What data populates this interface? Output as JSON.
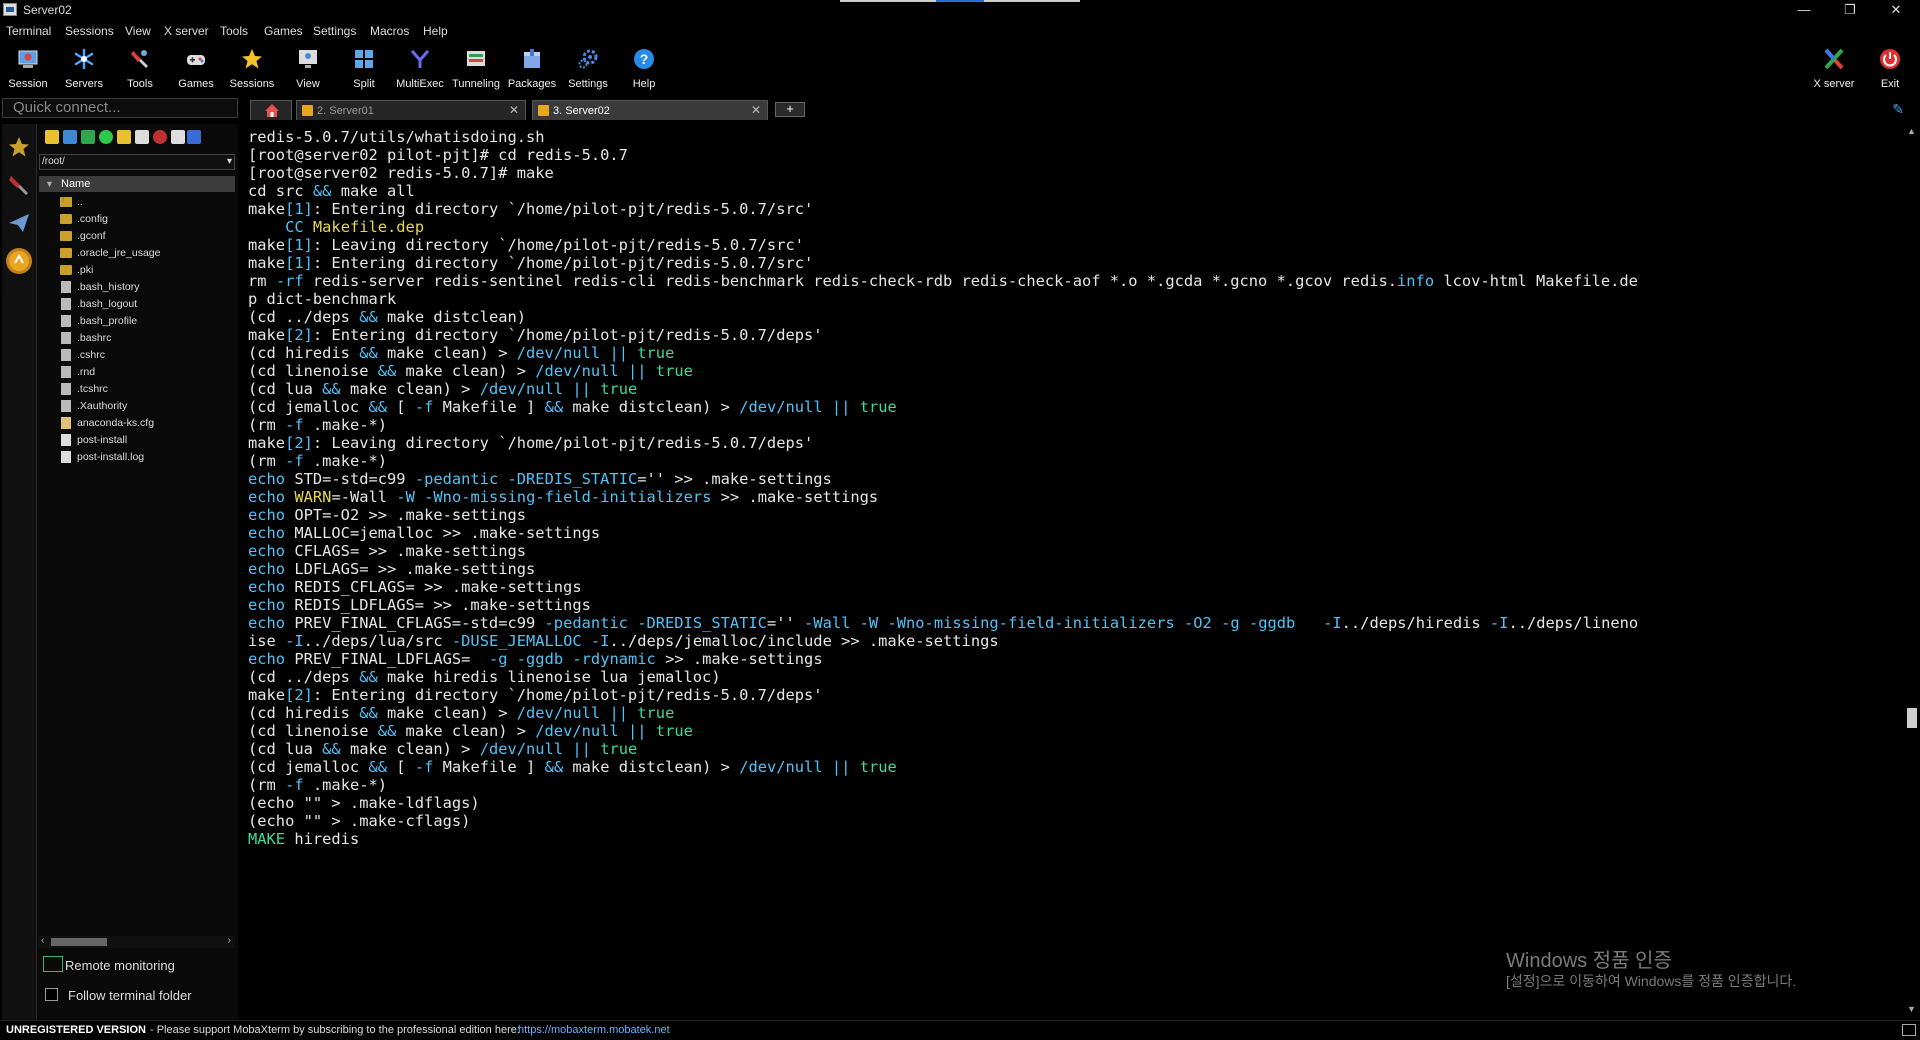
{
  "window": {
    "title": "Server02",
    "minimize": "—",
    "restore": "❐",
    "close": "✕"
  },
  "menu": [
    "Terminal",
    "Sessions",
    "View",
    "X server",
    "Tools",
    "Games",
    "Settings",
    "Macros",
    "Help"
  ],
  "toolbar": {
    "left": [
      {
        "label": "Session",
        "icon": "session-icon"
      },
      {
        "label": "Servers",
        "icon": "servers-icon"
      },
      {
        "label": "Tools",
        "icon": "tools-icon"
      },
      {
        "label": "Games",
        "icon": "games-icon"
      },
      {
        "label": "Sessions",
        "icon": "star-icon"
      },
      {
        "label": "View",
        "icon": "view-icon"
      },
      {
        "label": "Split",
        "icon": "split-icon"
      },
      {
        "label": "MultiExec",
        "icon": "multiexec-icon"
      },
      {
        "label": "Tunneling",
        "icon": "tunneling-icon"
      },
      {
        "label": "Packages",
        "icon": "packages-icon"
      },
      {
        "label": "Settings",
        "icon": "settings-icon"
      },
      {
        "label": "Help",
        "icon": "help-icon"
      }
    ],
    "right": [
      {
        "label": "X server",
        "icon": "x-server-icon"
      },
      {
        "label": "Exit",
        "icon": "power-icon"
      }
    ]
  },
  "quick_connect": {
    "placeholder": "Quick connect..."
  },
  "tabs": [
    {
      "label": "2. Server01",
      "close": "✕",
      "active": false
    },
    {
      "label": "3. Server02",
      "close": "✕",
      "active": true
    }
  ],
  "new_tab": "+",
  "sftp": {
    "path": "/root/",
    "column_name": "Name",
    "files": [
      {
        "name": "..",
        "type": "up"
      },
      {
        "name": ".config",
        "type": "folder"
      },
      {
        "name": ".gconf",
        "type": "folder"
      },
      {
        "name": ".oracle_jre_usage",
        "type": "folder"
      },
      {
        "name": ".pki",
        "type": "folder"
      },
      {
        "name": ".bash_history",
        "type": "file"
      },
      {
        "name": ".bash_logout",
        "type": "file"
      },
      {
        "name": ".bash_profile",
        "type": "file"
      },
      {
        "name": ".bashrc",
        "type": "file"
      },
      {
        "name": ".cshrc",
        "type": "file"
      },
      {
        "name": ".rnd",
        "type": "file"
      },
      {
        "name": ".tcshrc",
        "type": "file"
      },
      {
        "name": ".Xauthority",
        "type": "file"
      },
      {
        "name": "anaconda-ks.cfg",
        "type": "cfg"
      },
      {
        "name": "post-install",
        "type": "text"
      },
      {
        "name": "post-install.log",
        "type": "text"
      }
    ],
    "remote_monitoring": "Remote monitoring",
    "follow_terminal_folder": "Follow terminal folder"
  },
  "terminal_lines": [
    [
      [
        "redis-5.0.7/utils/whatisdoing.sh",
        ""
      ]
    ],
    [
      [
        "[root@server02 pilot-pjt]# cd redis-5.0.7",
        ""
      ]
    ],
    [
      [
        "[root@server02 redis-5.0.7]# make",
        ""
      ]
    ],
    [
      [
        "cd src ",
        ""
      ],
      [
        "&&",
        "cmd"
      ],
      [
        " make all",
        ""
      ]
    ],
    [
      [
        "make",
        ""
      ],
      [
        "[1]",
        "cmd"
      ],
      [
        ": Entering directory `/home/pilot-pjt/redis-5.0.7/src'",
        ""
      ]
    ],
    [
      [
        "    ",
        ""
      ],
      [
        "CC ",
        "cmd"
      ],
      [
        "Makefile.dep",
        "yellow"
      ]
    ],
    [
      [
        "make",
        ""
      ],
      [
        "[1]",
        "cmd"
      ],
      [
        ": Leaving directory `/home/pilot-pjt/redis-5.0.7/src'",
        ""
      ]
    ],
    [
      [
        "make",
        ""
      ],
      [
        "[1]",
        "cmd"
      ],
      [
        ": Entering directory `/home/pilot-pjt/redis-5.0.7/src'",
        ""
      ]
    ],
    [
      [
        "rm ",
        ""
      ],
      [
        "-rf",
        "cmd"
      ],
      [
        " redis-server redis-sentinel redis-cli redis-benchmark redis-check-rdb redis-check-aof *.o *.gcda *.gcno *.gcov redis.",
        ""
      ],
      [
        "info",
        "cmd"
      ],
      [
        " lcov-html Makefile.de",
        ""
      ]
    ],
    [
      [
        "p dict-benchmark",
        ""
      ]
    ],
    [
      [
        "(cd ../deps ",
        ""
      ],
      [
        "&&",
        "cmd"
      ],
      [
        " make distclean)",
        ""
      ]
    ],
    [
      [
        "make",
        ""
      ],
      [
        "[2]",
        "cmd"
      ],
      [
        ": Entering directory `/home/pilot-pjt/redis-5.0.7/deps'",
        ""
      ]
    ],
    [
      [
        "(cd hiredis ",
        ""
      ],
      [
        "&&",
        "cmd"
      ],
      [
        " make clean) > ",
        ""
      ],
      [
        "/dev/null",
        "cmd"
      ],
      [
        " ",
        ""
      ],
      [
        "||",
        "cmd"
      ],
      [
        " ",
        ""
      ],
      [
        "true",
        "true"
      ]
    ],
    [
      [
        "(cd linenoise ",
        ""
      ],
      [
        "&&",
        "cmd"
      ],
      [
        " make clean) > ",
        ""
      ],
      [
        "/dev/null",
        "cmd"
      ],
      [
        " ",
        ""
      ],
      [
        "||",
        "cmd"
      ],
      [
        " ",
        ""
      ],
      [
        "true",
        "true"
      ]
    ],
    [
      [
        "(cd lua ",
        ""
      ],
      [
        "&&",
        "cmd"
      ],
      [
        " make clean) > ",
        ""
      ],
      [
        "/dev/null",
        "cmd"
      ],
      [
        " ",
        ""
      ],
      [
        "||",
        "cmd"
      ],
      [
        " ",
        ""
      ],
      [
        "true",
        "true"
      ]
    ],
    [
      [
        "(cd jemalloc ",
        ""
      ],
      [
        "&&",
        "cmd"
      ],
      [
        " [ ",
        ""
      ],
      [
        "-f",
        "cmd"
      ],
      [
        " Makefile ] ",
        ""
      ],
      [
        "&&",
        "cmd"
      ],
      [
        " make distclean) > ",
        ""
      ],
      [
        "/dev/null",
        "cmd"
      ],
      [
        " ",
        ""
      ],
      [
        "||",
        "cmd"
      ],
      [
        " ",
        ""
      ],
      [
        "true",
        "true"
      ]
    ],
    [
      [
        "(rm ",
        ""
      ],
      [
        "-f",
        "cmd"
      ],
      [
        " .make-*)",
        ""
      ]
    ],
    [
      [
        "make",
        ""
      ],
      [
        "[2]",
        "cmd"
      ],
      [
        ": Leaving directory `/home/pilot-pjt/redis-5.0.7/deps'",
        ""
      ]
    ],
    [
      [
        "(rm ",
        ""
      ],
      [
        "-f",
        "cmd"
      ],
      [
        " .make-*)",
        ""
      ]
    ],
    [
      [
        "echo",
        "cmd"
      ],
      [
        " STD=-std=c99 ",
        ""
      ],
      [
        "-pedantic",
        "cmd"
      ],
      [
        " ",
        ""
      ],
      [
        "-DREDIS_STATIC",
        "cmd"
      ],
      [
        "='' >> .make-settings",
        ""
      ]
    ],
    [
      [
        "echo",
        "cmd"
      ],
      [
        " ",
        ""
      ],
      [
        "WARN",
        "yellow"
      ],
      [
        "=-Wall ",
        ""
      ],
      [
        "-W",
        "cmd"
      ],
      [
        " ",
        ""
      ],
      [
        "-Wno-missing-field-initializers",
        "cmd"
      ],
      [
        " >> .make-settings",
        ""
      ]
    ],
    [
      [
        "echo",
        "cmd"
      ],
      [
        " OPT=-O2 >> .make-settings",
        ""
      ]
    ],
    [
      [
        "echo",
        "cmd"
      ],
      [
        " MALLOC=jemalloc >> .make-settings",
        ""
      ]
    ],
    [
      [
        "echo",
        "cmd"
      ],
      [
        " CFLAGS= >> .make-settings",
        ""
      ]
    ],
    [
      [
        "echo",
        "cmd"
      ],
      [
        " LDFLAGS= >> .make-settings",
        ""
      ]
    ],
    [
      [
        "echo",
        "cmd"
      ],
      [
        " REDIS_CFLAGS= >> .make-settings",
        ""
      ]
    ],
    [
      [
        "echo",
        "cmd"
      ],
      [
        " REDIS_LDFLAGS= >> .make-settings",
        ""
      ]
    ],
    [
      [
        "echo",
        "cmd"
      ],
      [
        " PREV_FINAL_CFLAGS=-std=c99 ",
        ""
      ],
      [
        "-pedantic",
        "cmd"
      ],
      [
        " ",
        ""
      ],
      [
        "-DREDIS_STATIC",
        "cmd"
      ],
      [
        "='' ",
        ""
      ],
      [
        "-Wall",
        "cmd"
      ],
      [
        " ",
        ""
      ],
      [
        "-W",
        "cmd"
      ],
      [
        " ",
        ""
      ],
      [
        "-Wno-missing-field-initializers",
        "cmd"
      ],
      [
        " ",
        ""
      ],
      [
        "-O2",
        "cmd"
      ],
      [
        " ",
        ""
      ],
      [
        "-g",
        "cmd"
      ],
      [
        " ",
        ""
      ],
      [
        "-ggdb",
        "cmd"
      ],
      [
        "   ",
        ""
      ],
      [
        "-I",
        "cmd"
      ],
      [
        "../deps/hiredis ",
        ""
      ],
      [
        "-I",
        "cmd"
      ],
      [
        "../deps/lineno",
        ""
      ]
    ],
    [
      [
        "ise ",
        ""
      ],
      [
        "-I",
        "cmd"
      ],
      [
        "../deps/lua/src ",
        ""
      ],
      [
        "-DUSE_JEMALLOC",
        "cmd"
      ],
      [
        " ",
        ""
      ],
      [
        "-I",
        "cmd"
      ],
      [
        "../deps/jemalloc/include >> .make-settings",
        ""
      ]
    ],
    [
      [
        "echo",
        "cmd"
      ],
      [
        " PREV_FINAL_LDFLAGS=  ",
        ""
      ],
      [
        "-g",
        "cmd"
      ],
      [
        " ",
        ""
      ],
      [
        "-ggdb",
        "cmd"
      ],
      [
        " ",
        ""
      ],
      [
        "-rdynamic",
        "cmd"
      ],
      [
        " >> .make-settings",
        ""
      ]
    ],
    [
      [
        "(cd ../deps ",
        ""
      ],
      [
        "&&",
        "cmd"
      ],
      [
        " make hiredis linenoise lua jemalloc)",
        ""
      ]
    ],
    [
      [
        "make",
        ""
      ],
      [
        "[2]",
        "cmd"
      ],
      [
        ": Entering directory `/home/pilot-pjt/redis-5.0.7/deps'",
        ""
      ]
    ],
    [
      [
        "(cd hiredis ",
        ""
      ],
      [
        "&&",
        "cmd"
      ],
      [
        " make clean) > ",
        ""
      ],
      [
        "/dev/null",
        "cmd"
      ],
      [
        " ",
        ""
      ],
      [
        "||",
        "cmd"
      ],
      [
        " ",
        ""
      ],
      [
        "true",
        "true"
      ]
    ],
    [
      [
        "(cd linenoise ",
        ""
      ],
      [
        "&&",
        "cmd"
      ],
      [
        " make clean) > ",
        ""
      ],
      [
        "/dev/null",
        "cmd"
      ],
      [
        " ",
        ""
      ],
      [
        "||",
        "cmd"
      ],
      [
        " ",
        ""
      ],
      [
        "true",
        "true"
      ]
    ],
    [
      [
        "(cd lua ",
        ""
      ],
      [
        "&&",
        "cmd"
      ],
      [
        " make clean) > ",
        ""
      ],
      [
        "/dev/null",
        "cmd"
      ],
      [
        " ",
        ""
      ],
      [
        "||",
        "cmd"
      ],
      [
        " ",
        ""
      ],
      [
        "true",
        "true"
      ]
    ],
    [
      [
        "(cd jemalloc ",
        ""
      ],
      [
        "&&",
        "cmd"
      ],
      [
        " [ ",
        ""
      ],
      [
        "-f",
        "cmd"
      ],
      [
        " Makefile ] ",
        ""
      ],
      [
        "&&",
        "cmd"
      ],
      [
        " make distclean) > ",
        ""
      ],
      [
        "/dev/null",
        "cmd"
      ],
      [
        " ",
        ""
      ],
      [
        "||",
        "cmd"
      ],
      [
        " ",
        ""
      ],
      [
        "true",
        "true"
      ]
    ],
    [
      [
        "(rm ",
        ""
      ],
      [
        "-f",
        "cmd"
      ],
      [
        " .make-*)",
        ""
      ]
    ],
    [
      [
        "(echo \"\" > .make-ldflags)",
        ""
      ]
    ],
    [
      [
        "(echo \"\" > .make-cflags)",
        ""
      ]
    ],
    [
      [
        "MAKE",
        "green"
      ],
      [
        " hiredis",
        ""
      ]
    ]
  ],
  "watermark": {
    "title": "Windows 정품 인증",
    "subtitle": "[설정]으로 이동하여 Windows를 정품 인증합니다."
  },
  "status": {
    "bold": "UNREGISTERED VERSION",
    "message": "-  Please support MobaXterm by subscribing to the professional edition here:",
    "link": "https://mobaxterm.mobatek.net"
  },
  "colors": {
    "cmd": "#4fc3f7",
    "true": "#3ddc97",
    "yellow": "#e6d84a",
    "green": "#3ddc97"
  }
}
